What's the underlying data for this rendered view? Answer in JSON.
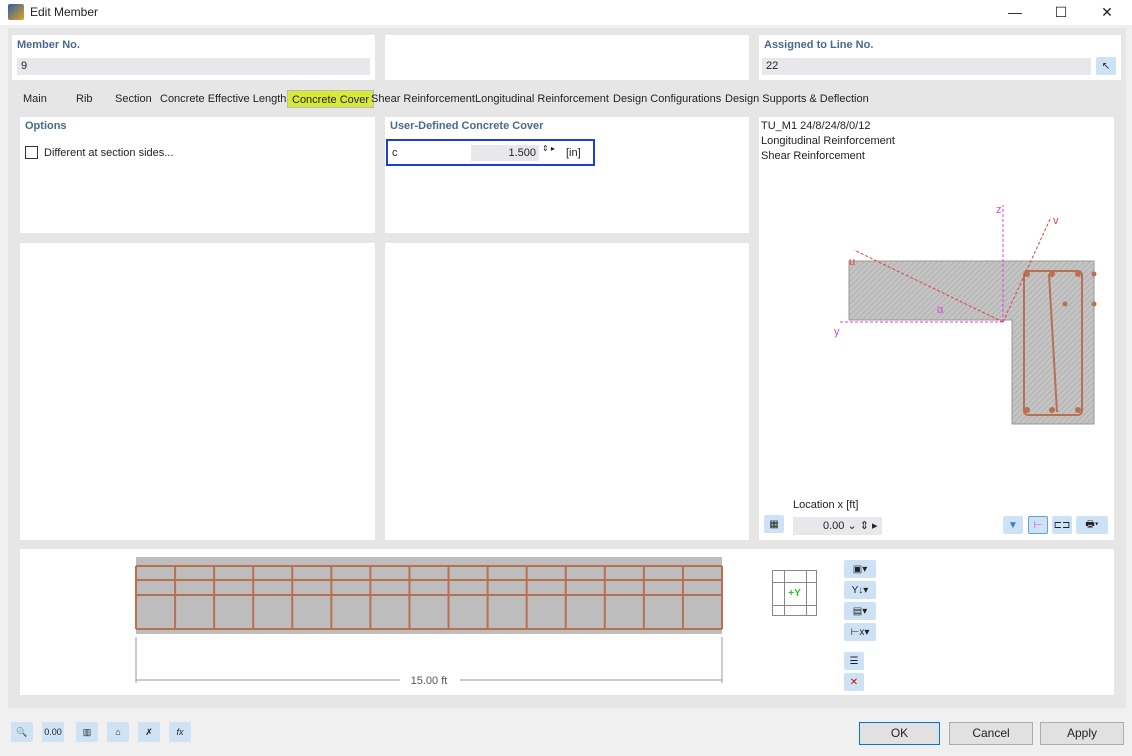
{
  "window": {
    "title": "Edit Member",
    "min": "—",
    "max": "☐",
    "close": "✕"
  },
  "member": {
    "label": "Member No.",
    "value": "9"
  },
  "assigned": {
    "label": "Assigned to Line No.",
    "value": "22"
  },
  "tabs": [
    {
      "label": "Main"
    },
    {
      "label": "Rib"
    },
    {
      "label": "Section"
    },
    {
      "label": "Concrete Effective Lengths"
    },
    {
      "label": "Concrete Cover"
    },
    {
      "label": "Shear Reinforcement"
    },
    {
      "label": "Longitudinal Reinforcement"
    },
    {
      "label": "Design Configurations"
    },
    {
      "label": "Design Supports & Deflection"
    }
  ],
  "options": {
    "title": "Options",
    "different_label": "Different at section sides...",
    "checked": false
  },
  "cover": {
    "title": "User-Defined Concrete Cover",
    "symbol": "c",
    "value": "1.500",
    "unit": "[in]",
    "highlight_color": "#1a3fd6"
  },
  "preview": {
    "lines": [
      "TU_M1 24/8/24/8/0/12",
      "Longitudinal Reinforcement",
      "Shear Reinforcement"
    ],
    "axes": {
      "z": "z",
      "v": "v",
      "u": "u",
      "y": "y",
      "alpha": "α"
    },
    "location_label": "Location x [ft]",
    "location_value": "0.00"
  },
  "beam": {
    "length_label": "15.00 ft",
    "view_label": "+Y"
  },
  "footer": {
    "ok": "OK",
    "cancel": "Cancel",
    "apply": "Apply",
    "tool_value": "0.00"
  },
  "colors": {
    "rebar": "#b87050",
    "axis": "#e040e0",
    "accent_tab": "#d7ea3a"
  }
}
